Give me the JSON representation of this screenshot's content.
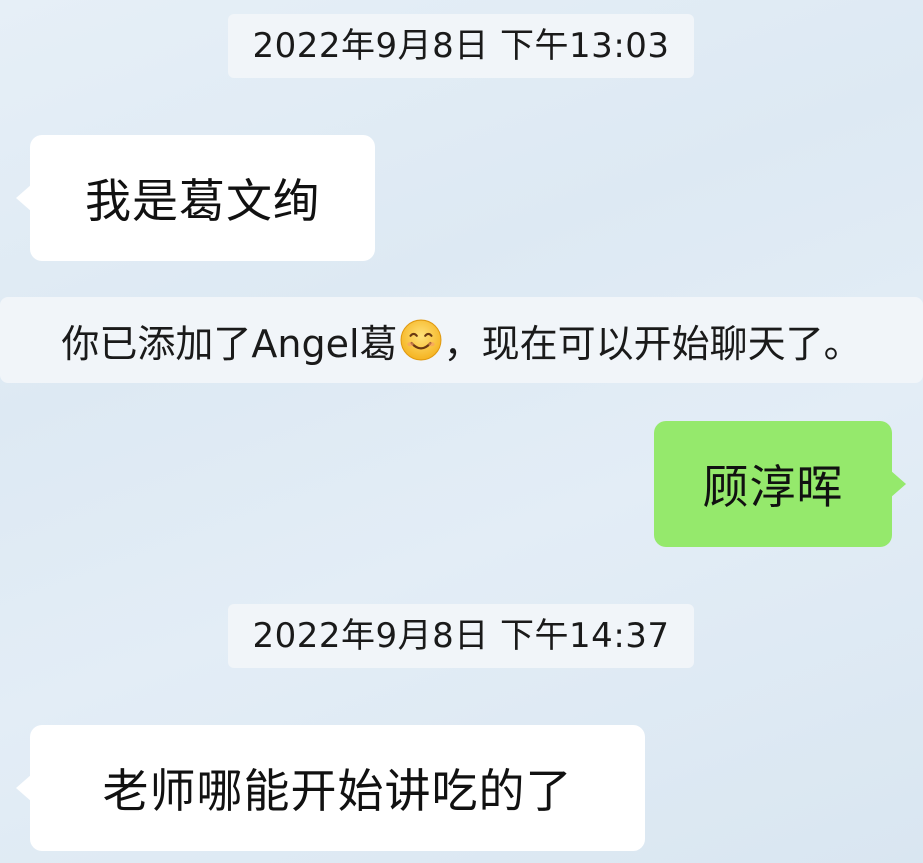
{
  "messages": [
    {
      "type": "timestamp",
      "text": "2022年9月8日 下午13:03"
    },
    {
      "type": "incoming",
      "text": "我是葛文绚"
    },
    {
      "type": "system",
      "before": "你已添加了Angel葛",
      "icon": "smiling-face-emoji",
      "after": "，现在可以开始聊天了。"
    },
    {
      "type": "outgoing",
      "text": "顾淳晖"
    },
    {
      "type": "timestamp",
      "text": "2022年9月8日 下午14:37"
    },
    {
      "type": "incoming",
      "text": "老师哪能开始讲吃的了"
    }
  ],
  "colors": {
    "outgoing_bubble": "#95e96c",
    "incoming_bubble": "#ffffff",
    "timestamp_bg": "#f1f5f9",
    "background": "#e2ecf5"
  }
}
